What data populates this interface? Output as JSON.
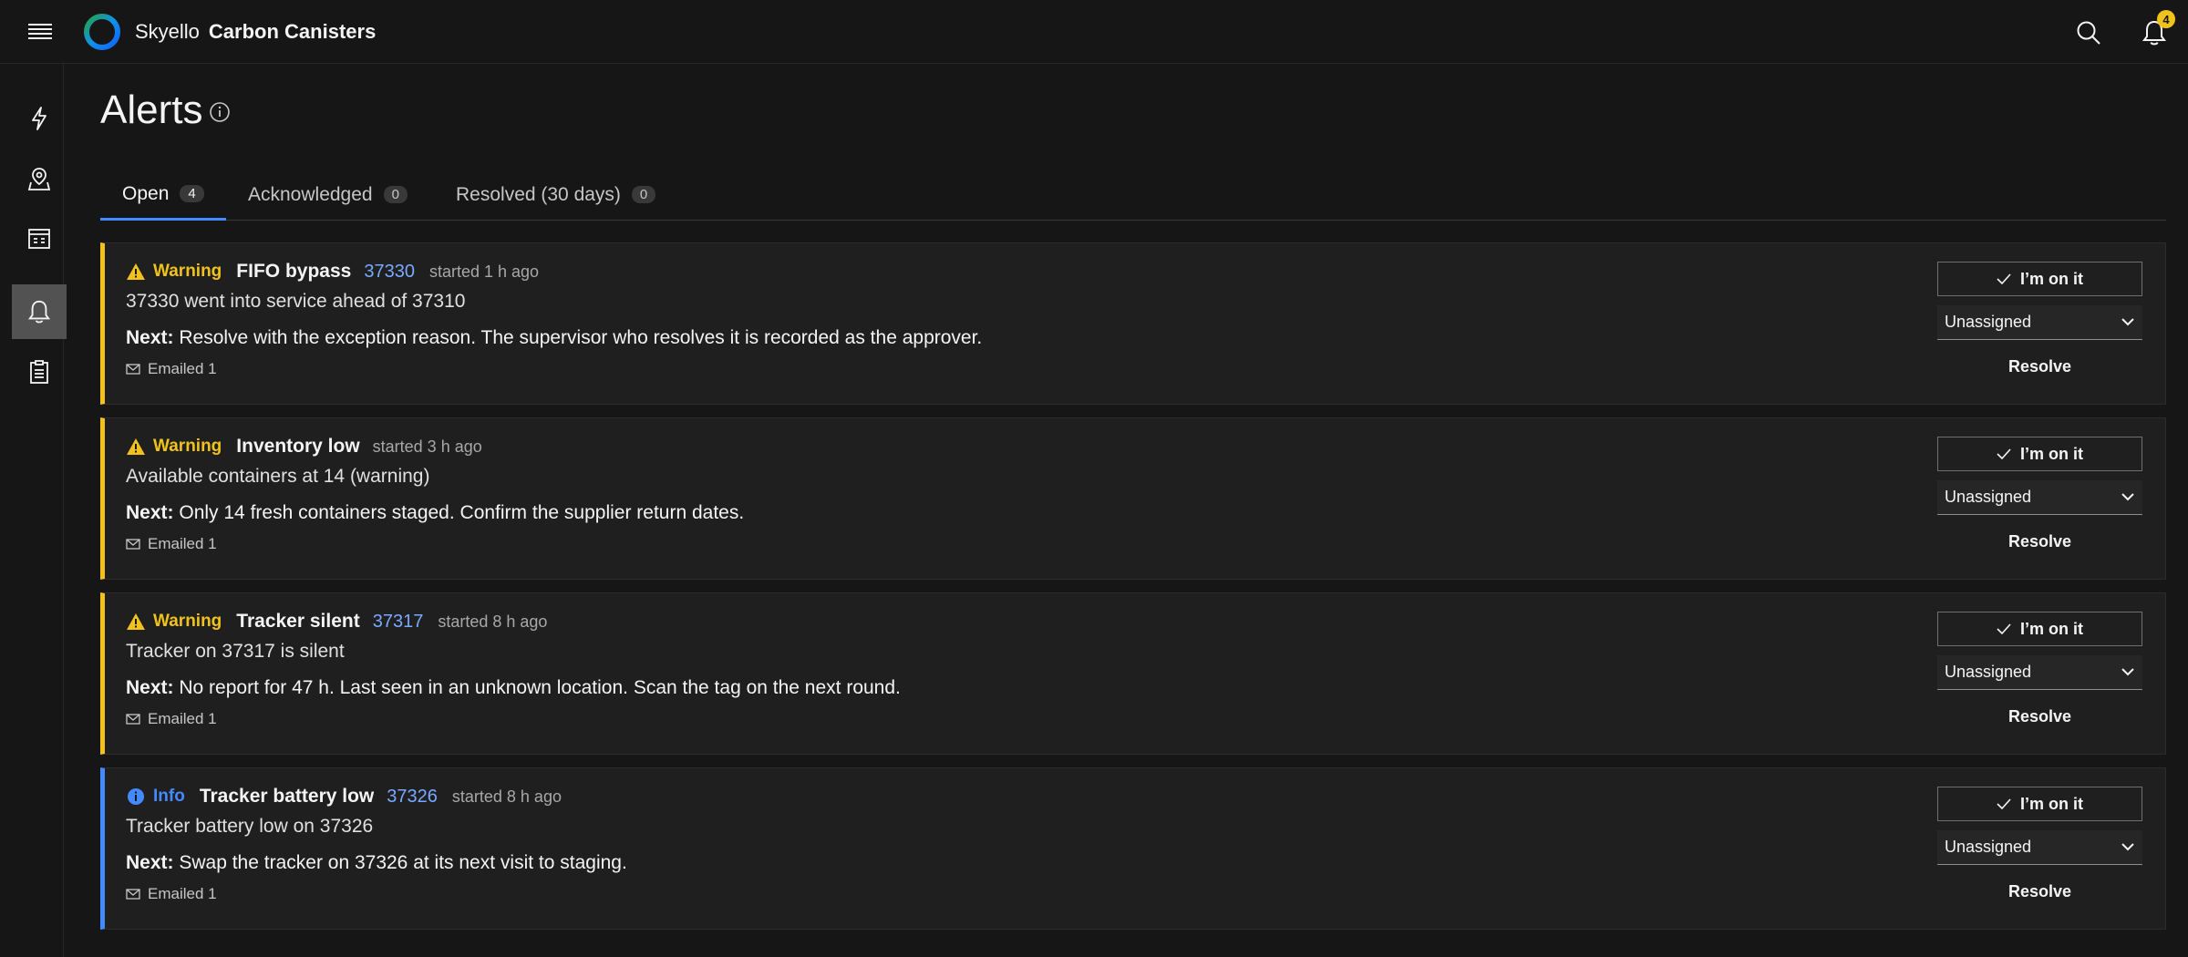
{
  "header": {
    "company": "Skyello",
    "product": "Carbon Canisters",
    "notification_count": "4"
  },
  "page": {
    "title": "Alerts"
  },
  "tabs": [
    {
      "label": "Open",
      "count": "4"
    },
    {
      "label": "Acknowledged",
      "count": "0"
    },
    {
      "label": "Resolved (30 days)",
      "count": "0"
    }
  ],
  "alerts": [
    {
      "severity": "Warning",
      "title": "FIFO bypass",
      "asset": "37330",
      "started": "started 1 h ago",
      "description": "37330 went into service ahead of 37310",
      "next_label": "Next:",
      "next": "Resolve with the exception reason. The supervisor who resolves it is recorded as the approver.",
      "emailed": "Emailed 1",
      "onit_label": "I’m on it",
      "assignee": "Unassigned",
      "resolve_label": "Resolve"
    },
    {
      "severity": "Warning",
      "title": "Inventory low",
      "asset": "",
      "started": "started 3 h ago",
      "description": "Available containers at 14 (warning)",
      "next_label": "Next:",
      "next": "Only 14 fresh containers staged. Confirm the supplier return dates.",
      "emailed": "Emailed 1",
      "onit_label": "I’m on it",
      "assignee": "Unassigned",
      "resolve_label": "Resolve"
    },
    {
      "severity": "Warning",
      "title": "Tracker silent",
      "asset": "37317",
      "started": "started 8 h ago",
      "description": "Tracker on 37317 is silent",
      "next_label": "Next:",
      "next": "No report for 47 h. Last seen in an unknown location. Scan the tag on the next round.",
      "emailed": "Emailed 1",
      "onit_label": "I’m on it",
      "assignee": "Unassigned",
      "resolve_label": "Resolve"
    },
    {
      "severity": "Info",
      "title": "Tracker battery low",
      "asset": "37326",
      "started": "started 8 h ago",
      "description": "Tracker battery low on 37326",
      "next_label": "Next:",
      "next": "Swap the tracker on 37326 at its next visit to staging.",
      "emailed": "Emailed 1",
      "onit_label": "I’m on it",
      "assignee": "Unassigned",
      "resolve_label": "Resolve"
    }
  ],
  "icons": {
    "menu": "hamburger-menu-icon",
    "search": "search-icon",
    "notifications": "bell-icon",
    "sidebar": [
      "lightning-icon",
      "map-pin-icon",
      "dashboard-icon",
      "bell-icon",
      "clipboard-icon"
    ],
    "warning": "warning-triangle-icon",
    "info": "info-circle-icon",
    "email": "envelope-icon",
    "check": "checkmark-icon",
    "chevron": "chevron-down-icon"
  },
  "colors": {
    "warning": "#f1c21b",
    "info": "#4589ff",
    "link": "#78a9ff",
    "background": "#161616",
    "card": "#1f1f1f"
  }
}
